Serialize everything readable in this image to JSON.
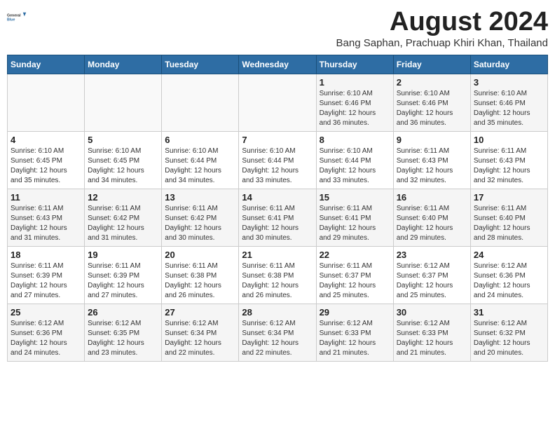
{
  "header": {
    "logo_general": "General",
    "logo_blue": "Blue",
    "title": "August 2024",
    "subtitle": "Bang Saphan, Prachuap Khiri Khan, Thailand"
  },
  "days_of_week": [
    "Sunday",
    "Monday",
    "Tuesday",
    "Wednesday",
    "Thursday",
    "Friday",
    "Saturday"
  ],
  "weeks": [
    [
      {
        "day": "",
        "info": ""
      },
      {
        "day": "",
        "info": ""
      },
      {
        "day": "",
        "info": ""
      },
      {
        "day": "",
        "info": ""
      },
      {
        "day": "1",
        "info": "Sunrise: 6:10 AM\nSunset: 6:46 PM\nDaylight: 12 hours\nand 36 minutes."
      },
      {
        "day": "2",
        "info": "Sunrise: 6:10 AM\nSunset: 6:46 PM\nDaylight: 12 hours\nand 36 minutes."
      },
      {
        "day": "3",
        "info": "Sunrise: 6:10 AM\nSunset: 6:46 PM\nDaylight: 12 hours\nand 35 minutes."
      }
    ],
    [
      {
        "day": "4",
        "info": "Sunrise: 6:10 AM\nSunset: 6:45 PM\nDaylight: 12 hours\nand 35 minutes."
      },
      {
        "day": "5",
        "info": "Sunrise: 6:10 AM\nSunset: 6:45 PM\nDaylight: 12 hours\nand 34 minutes."
      },
      {
        "day": "6",
        "info": "Sunrise: 6:10 AM\nSunset: 6:44 PM\nDaylight: 12 hours\nand 34 minutes."
      },
      {
        "day": "7",
        "info": "Sunrise: 6:10 AM\nSunset: 6:44 PM\nDaylight: 12 hours\nand 33 minutes."
      },
      {
        "day": "8",
        "info": "Sunrise: 6:10 AM\nSunset: 6:44 PM\nDaylight: 12 hours\nand 33 minutes."
      },
      {
        "day": "9",
        "info": "Sunrise: 6:11 AM\nSunset: 6:43 PM\nDaylight: 12 hours\nand 32 minutes."
      },
      {
        "day": "10",
        "info": "Sunrise: 6:11 AM\nSunset: 6:43 PM\nDaylight: 12 hours\nand 32 minutes."
      }
    ],
    [
      {
        "day": "11",
        "info": "Sunrise: 6:11 AM\nSunset: 6:43 PM\nDaylight: 12 hours\nand 31 minutes."
      },
      {
        "day": "12",
        "info": "Sunrise: 6:11 AM\nSunset: 6:42 PM\nDaylight: 12 hours\nand 31 minutes."
      },
      {
        "day": "13",
        "info": "Sunrise: 6:11 AM\nSunset: 6:42 PM\nDaylight: 12 hours\nand 30 minutes."
      },
      {
        "day": "14",
        "info": "Sunrise: 6:11 AM\nSunset: 6:41 PM\nDaylight: 12 hours\nand 30 minutes."
      },
      {
        "day": "15",
        "info": "Sunrise: 6:11 AM\nSunset: 6:41 PM\nDaylight: 12 hours\nand 29 minutes."
      },
      {
        "day": "16",
        "info": "Sunrise: 6:11 AM\nSunset: 6:40 PM\nDaylight: 12 hours\nand 29 minutes."
      },
      {
        "day": "17",
        "info": "Sunrise: 6:11 AM\nSunset: 6:40 PM\nDaylight: 12 hours\nand 28 minutes."
      }
    ],
    [
      {
        "day": "18",
        "info": "Sunrise: 6:11 AM\nSunset: 6:39 PM\nDaylight: 12 hours\nand 27 minutes."
      },
      {
        "day": "19",
        "info": "Sunrise: 6:11 AM\nSunset: 6:39 PM\nDaylight: 12 hours\nand 27 minutes."
      },
      {
        "day": "20",
        "info": "Sunrise: 6:11 AM\nSunset: 6:38 PM\nDaylight: 12 hours\nand 26 minutes."
      },
      {
        "day": "21",
        "info": "Sunrise: 6:11 AM\nSunset: 6:38 PM\nDaylight: 12 hours\nand 26 minutes."
      },
      {
        "day": "22",
        "info": "Sunrise: 6:11 AM\nSunset: 6:37 PM\nDaylight: 12 hours\nand 25 minutes."
      },
      {
        "day": "23",
        "info": "Sunrise: 6:12 AM\nSunset: 6:37 PM\nDaylight: 12 hours\nand 25 minutes."
      },
      {
        "day": "24",
        "info": "Sunrise: 6:12 AM\nSunset: 6:36 PM\nDaylight: 12 hours\nand 24 minutes."
      }
    ],
    [
      {
        "day": "25",
        "info": "Sunrise: 6:12 AM\nSunset: 6:36 PM\nDaylight: 12 hours\nand 24 minutes."
      },
      {
        "day": "26",
        "info": "Sunrise: 6:12 AM\nSunset: 6:35 PM\nDaylight: 12 hours\nand 23 minutes."
      },
      {
        "day": "27",
        "info": "Sunrise: 6:12 AM\nSunset: 6:34 PM\nDaylight: 12 hours\nand 22 minutes."
      },
      {
        "day": "28",
        "info": "Sunrise: 6:12 AM\nSunset: 6:34 PM\nDaylight: 12 hours\nand 22 minutes."
      },
      {
        "day": "29",
        "info": "Sunrise: 6:12 AM\nSunset: 6:33 PM\nDaylight: 12 hours\nand 21 minutes."
      },
      {
        "day": "30",
        "info": "Sunrise: 6:12 AM\nSunset: 6:33 PM\nDaylight: 12 hours\nand 21 minutes."
      },
      {
        "day": "31",
        "info": "Sunrise: 6:12 AM\nSunset: 6:32 PM\nDaylight: 12 hours\nand 20 minutes."
      }
    ]
  ]
}
